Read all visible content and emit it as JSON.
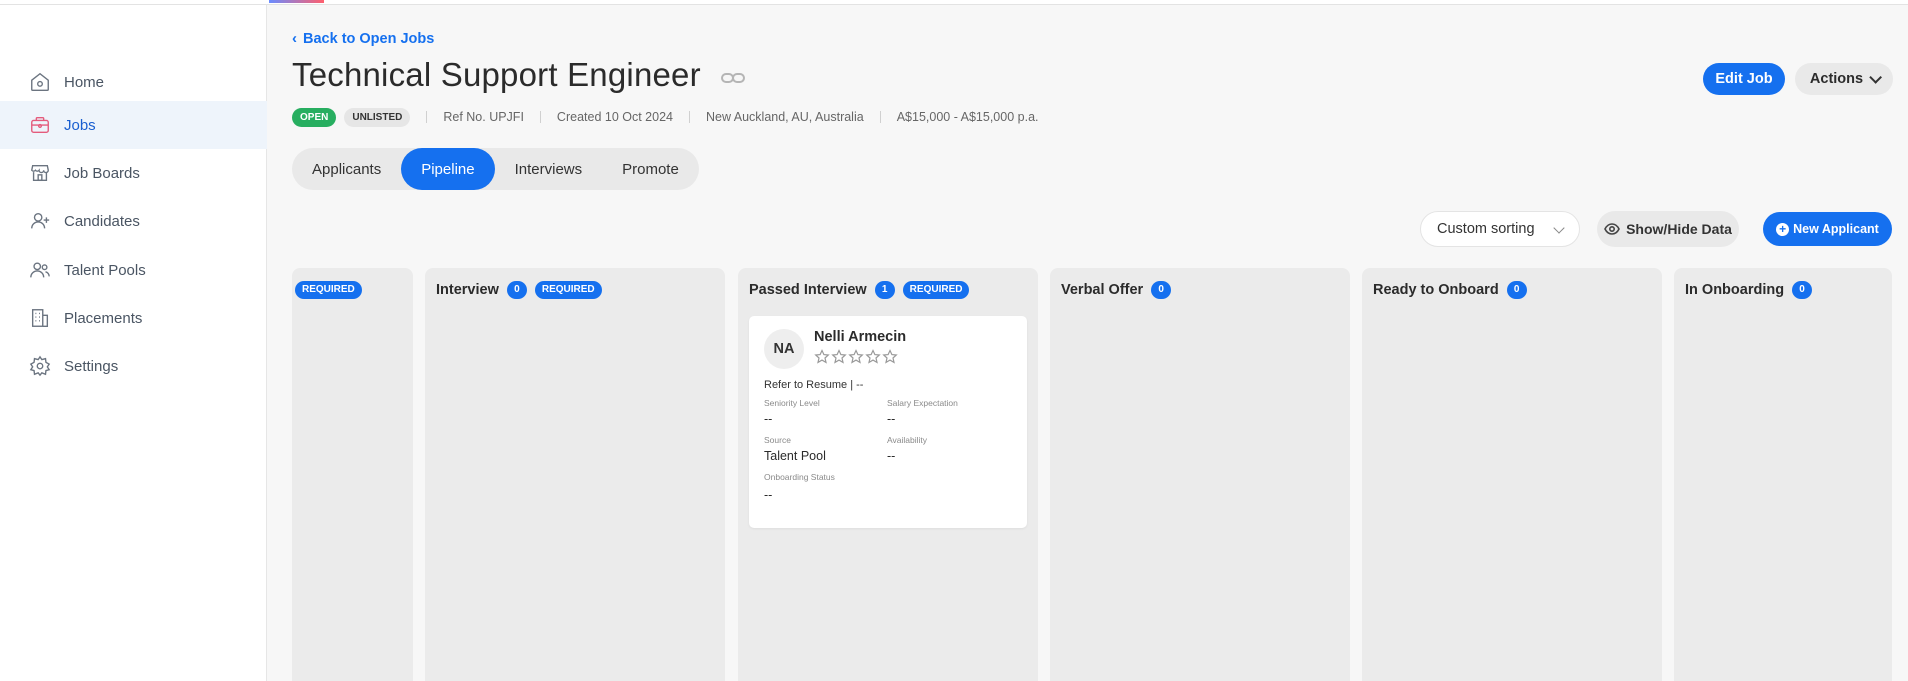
{
  "sidebar": {
    "items": [
      {
        "label": "Home",
        "icon": "home-icon"
      },
      {
        "label": "Jobs",
        "icon": "briefcase-icon",
        "active": true
      },
      {
        "label": "Job Boards",
        "icon": "storefront-icon"
      },
      {
        "label": "Candidates",
        "icon": "user-plus-icon"
      },
      {
        "label": "Talent Pools",
        "icon": "users-icon"
      },
      {
        "label": "Placements",
        "icon": "building-icon"
      },
      {
        "label": "Settings",
        "icon": "gear-icon"
      }
    ]
  },
  "header": {
    "back_label": "Back to Open Jobs",
    "title": "Technical Support Engineer",
    "status_badge": "OPEN",
    "visibility_badge": "UNLISTED",
    "ref": "Ref No. UPJFI",
    "created": "Created 10 Oct 2024",
    "location": "New Auckland, AU, Australia",
    "salary": "A$15,000 - A$15,000 p.a.",
    "edit_label": "Edit Job",
    "actions_label": "Actions"
  },
  "tabs": [
    {
      "label": "Applicants"
    },
    {
      "label": "Pipeline",
      "active": true
    },
    {
      "label": "Interviews"
    },
    {
      "label": "Promote"
    }
  ],
  "toolbar": {
    "sort_value": "Custom sorting",
    "show_hide_label": "Show/Hide Data",
    "new_applicant_label": "New Applicant"
  },
  "columns": [
    {
      "name": "",
      "count": "",
      "required": "REQUIRED"
    },
    {
      "name": "Interview",
      "count": "0",
      "required": "REQUIRED"
    },
    {
      "name": "Passed Interview",
      "count": "1",
      "required": "REQUIRED"
    },
    {
      "name": "Verbal Offer",
      "count": "0",
      "required": ""
    },
    {
      "name": "Ready to Onboard",
      "count": "0",
      "required": ""
    },
    {
      "name": "In Onboarding",
      "count": "0",
      "required": ""
    }
  ],
  "card": {
    "initials": "NA",
    "name": "Nelli Armecin",
    "rating": 0,
    "resume": "Refer to Resume | --",
    "seniority_label": "Seniority Level",
    "seniority_value": "--",
    "salary_label": "Salary Expectation",
    "salary_value": "--",
    "source_label": "Source",
    "source_value": "Talent Pool",
    "availability_label": "Availability",
    "availability_value": "--",
    "onboarding_label": "Onboarding Status",
    "onboarding_value": "--"
  },
  "colors": {
    "primary": "#1570ef",
    "open_badge": "#27ae60",
    "active_nav_bg": "#eef4fb"
  }
}
